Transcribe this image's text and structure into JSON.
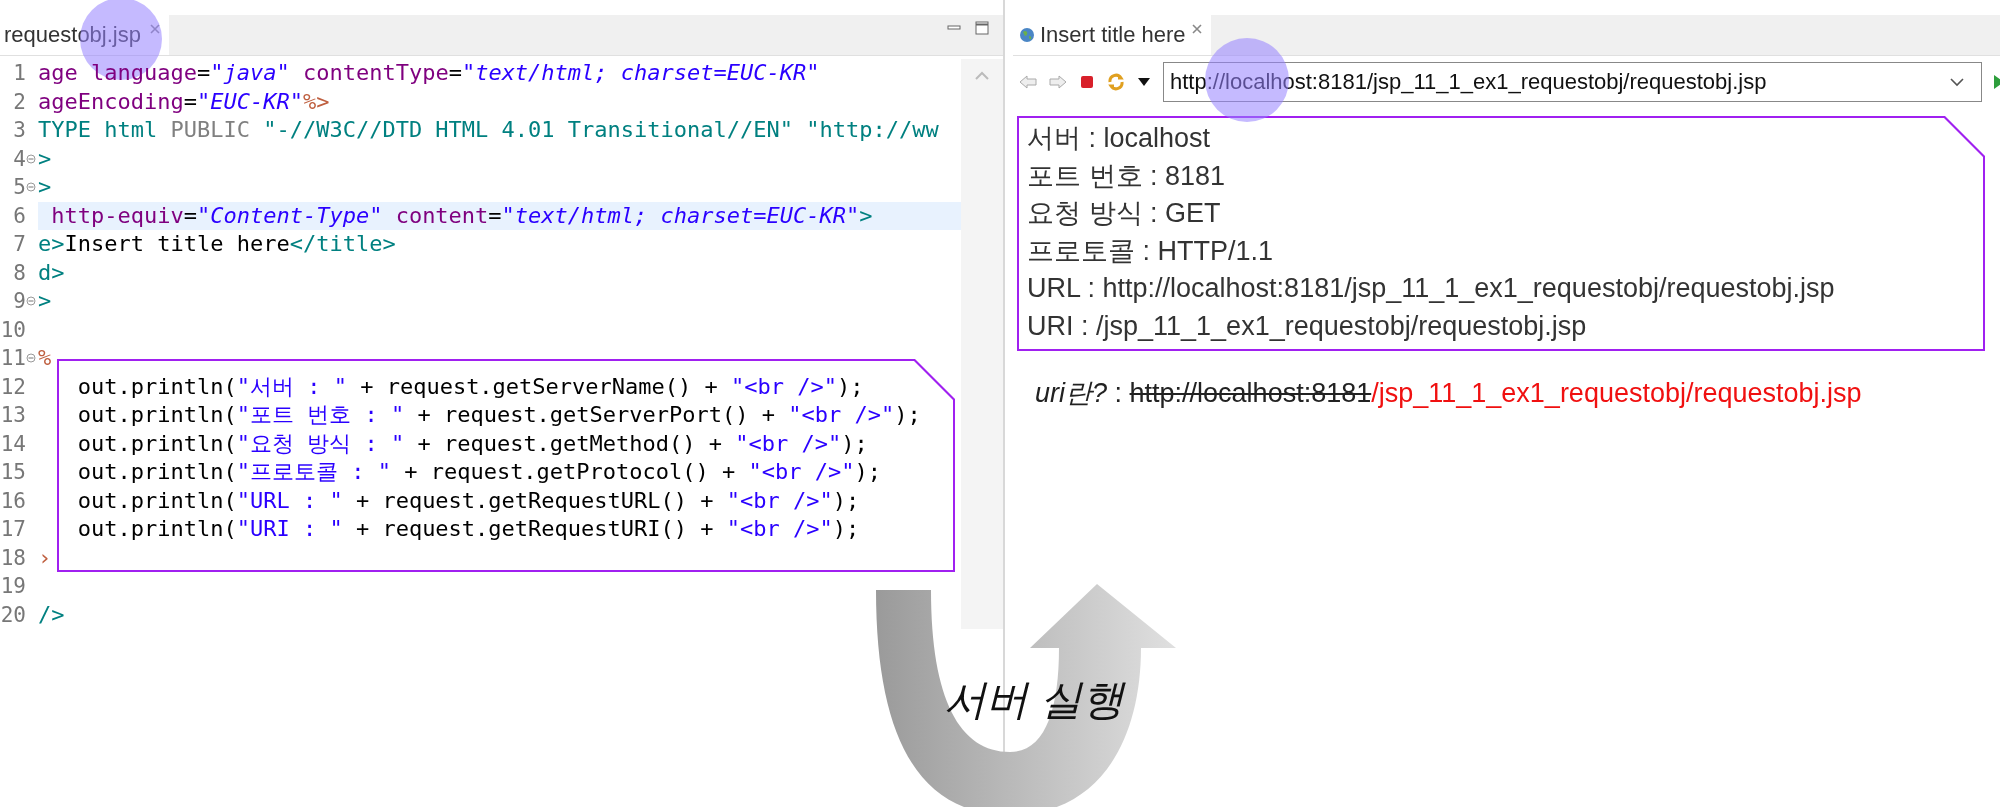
{
  "editor": {
    "tab": {
      "label": "requestobj.jsp",
      "selected": true
    },
    "lines": [
      {
        "number": "1",
        "fold": false,
        "highlighted": false,
        "segments": [
          {
            "kind": "attr",
            "text": "age language"
          },
          {
            "kind": "plain",
            "text": "="
          },
          {
            "kind": "string",
            "text": "\"java\""
          },
          {
            "kind": "attr",
            "text": " contentType"
          },
          {
            "kind": "plain",
            "text": "="
          },
          {
            "kind": "string",
            "text": "\"text/html; charset=EUC-KR\""
          }
        ]
      },
      {
        "number": "2",
        "fold": false,
        "highlighted": false,
        "segments": [
          {
            "kind": "attr",
            "text": "ageEncoding"
          },
          {
            "kind": "plain",
            "text": "="
          },
          {
            "kind": "string",
            "text": "\"EUC-KR\""
          },
          {
            "kind": "jsp",
            "text": "%>"
          }
        ]
      },
      {
        "number": "3",
        "fold": false,
        "highlighted": false,
        "segments": [
          {
            "kind": "tag",
            "text": "TYPE html "
          },
          {
            "kind": "grey",
            "text": "PUBLIC"
          },
          {
            "kind": "tag",
            "text": " \"-//W3C//DTD HTML 4.01 Transitional//EN\" \"http://ww"
          }
        ]
      },
      {
        "number": "4",
        "fold": true,
        "highlighted": false,
        "segments": [
          {
            "kind": "tag",
            "text": ">"
          }
        ]
      },
      {
        "number": "5",
        "fold": true,
        "highlighted": false,
        "segments": [
          {
            "kind": "tag",
            "text": ">"
          }
        ]
      },
      {
        "number": "6",
        "fold": false,
        "highlighted": true,
        "segments": [
          {
            "kind": "attr",
            "text": " http-equiv"
          },
          {
            "kind": "plain",
            "text": "="
          },
          {
            "kind": "string",
            "text": "\"Content-Type\""
          },
          {
            "kind": "attr",
            "text": " content"
          },
          {
            "kind": "plain",
            "text": "="
          },
          {
            "kind": "string",
            "text": "\"text/html; charset=EUC-KR\""
          },
          {
            "kind": "tag",
            "text": ">"
          }
        ]
      },
      {
        "number": "7",
        "fold": false,
        "highlighted": false,
        "segments": [
          {
            "kind": "tag",
            "text": "e>"
          },
          {
            "kind": "plain",
            "text": "Insert title here"
          },
          {
            "kind": "tag",
            "text": "</title>"
          }
        ]
      },
      {
        "number": "8",
        "fold": false,
        "highlighted": false,
        "segments": [
          {
            "kind": "tag",
            "text": "d>"
          }
        ]
      },
      {
        "number": "9",
        "fold": true,
        "highlighted": false,
        "segments": [
          {
            "kind": "tag",
            "text": ">"
          }
        ]
      },
      {
        "number": "10",
        "fold": false,
        "highlighted": false
      },
      {
        "number": "11",
        "fold": true,
        "highlighted": false,
        "segments": [
          {
            "kind": "jsp",
            "text": "%"
          }
        ]
      },
      {
        "number": "12",
        "fold": false,
        "highlighted": false,
        "segments": [
          {
            "kind": "plain",
            "text": "   out.println("
          },
          {
            "kind": "jstring",
            "text": "\"서버 : \""
          },
          {
            "kind": "plain",
            "text": " + request.getServerName() + "
          },
          {
            "kind": "jstring",
            "text": "\"<br />\""
          },
          {
            "kind": "plain",
            "text": ");"
          }
        ]
      },
      {
        "number": "13",
        "fold": false,
        "highlighted": false,
        "segments": [
          {
            "kind": "plain",
            "text": "   out.println("
          },
          {
            "kind": "jstring",
            "text": "\"포트 번호 : \""
          },
          {
            "kind": "plain",
            "text": " + request.getServerPort() + "
          },
          {
            "kind": "jstring",
            "text": "\"<br />\""
          },
          {
            "kind": "plain",
            "text": ");"
          }
        ]
      },
      {
        "number": "14",
        "fold": false,
        "highlighted": false,
        "segments": [
          {
            "kind": "plain",
            "text": "   out.println("
          },
          {
            "kind": "jstring",
            "text": "\"요청 방식 : \""
          },
          {
            "kind": "plain",
            "text": " + request.getMethod() + "
          },
          {
            "kind": "jstring",
            "text": "\"<br />\""
          },
          {
            "kind": "plain",
            "text": ");"
          }
        ]
      },
      {
        "number": "15",
        "fold": false,
        "highlighted": false,
        "segments": [
          {
            "kind": "plain",
            "text": "   out.println("
          },
          {
            "kind": "jstring",
            "text": "\"프로토콜 : \""
          },
          {
            "kind": "plain",
            "text": " + request.getProtocol() + "
          },
          {
            "kind": "jstring",
            "text": "\"<br />\""
          },
          {
            "kind": "plain",
            "text": ");"
          }
        ]
      },
      {
        "number": "16",
        "fold": false,
        "highlighted": false,
        "segments": [
          {
            "kind": "plain",
            "text": "   out.println("
          },
          {
            "kind": "jstring",
            "text": "\"URL : \""
          },
          {
            "kind": "plain",
            "text": " + request.getRequestURL() + "
          },
          {
            "kind": "jstring",
            "text": "\"<br />\""
          },
          {
            "kind": "plain",
            "text": ");"
          }
        ]
      },
      {
        "number": "17",
        "fold": false,
        "highlighted": false,
        "segments": [
          {
            "kind": "plain",
            "text": "   out.println("
          },
          {
            "kind": "jstring",
            "text": "\"URI : \""
          },
          {
            "kind": "plain",
            "text": " + request.getRequestURI() + "
          },
          {
            "kind": "jstring",
            "text": "\"<br />\""
          },
          {
            "kind": "plain",
            "text": ");"
          }
        ]
      },
      {
        "number": "18",
        "fold": false,
        "highlighted": false,
        "segments": [
          {
            "kind": "jsp",
            "text": "›"
          }
        ]
      },
      {
        "number": "19",
        "fold": false,
        "highlighted": false
      },
      {
        "number": "20",
        "fold": false,
        "highlighted": false,
        "segments": [
          {
            "kind": "tag",
            "text": "/>"
          }
        ]
      }
    ]
  },
  "browser": {
    "tab": {
      "label": "Insert title here",
      "selected": true
    },
    "url": "http://localhost:8181/jsp_11_1_ex1_requestobj/requestobj.jsp",
    "output_lines": [
      "서버 : localhost",
      "포트 번호 : 8181",
      "요청 방식 : GET",
      "프로토콜 : HTTP/1.1",
      "URL : http://localhost:8181/jsp_11_1_ex1_requestobj/requestobj.jsp",
      "URI : /jsp_11_1_ex1_requestobj/requestobj.jsp"
    ],
    "note": [
      {
        "kind": "italic",
        "text": "uri란?"
      },
      {
        "kind": "plain",
        "text": " : "
      },
      {
        "kind": "strike",
        "text": "http://localhost:8181"
      },
      {
        "kind": "red",
        "text": "/jsp_11_1_ex1_requestobj/requestobj.jsp"
      }
    ]
  },
  "caption": "서버 실행"
}
